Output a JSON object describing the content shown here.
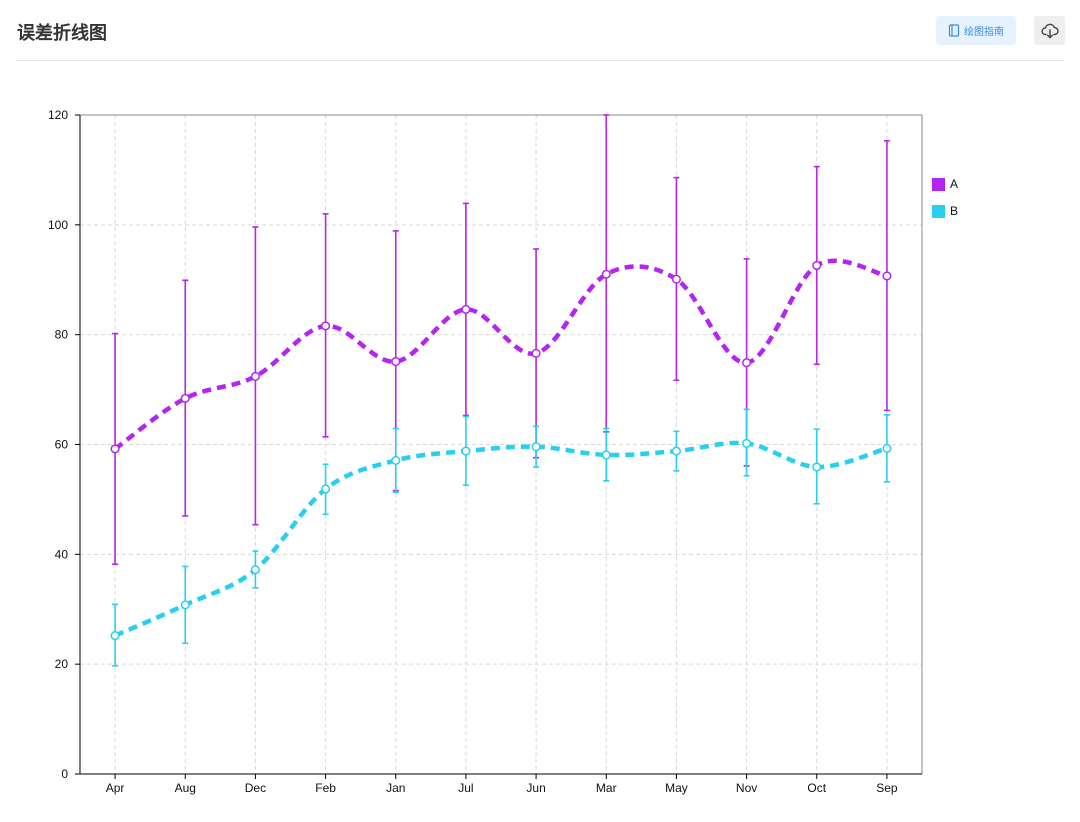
{
  "header": {
    "title": "误差折线图",
    "guide_label": "绘图指南",
    "guide_icon": "book-icon",
    "download_icon": "cloud-download-icon"
  },
  "chart_data": {
    "type": "line",
    "title": "",
    "xlabel": "",
    "ylabel": "",
    "categories": [
      "Apr",
      "Aug",
      "Dec",
      "Feb",
      "Jan",
      "Jul",
      "Jun",
      "Mar",
      "May",
      "Nov",
      "Oct",
      "Sep"
    ],
    "ylim": [
      0,
      120
    ],
    "yticks": [
      0,
      20,
      40,
      60,
      80,
      100,
      120
    ],
    "grid": true,
    "legend_position": "right",
    "line_style": "dashed-smooth",
    "series": [
      {
        "name": "A",
        "color": "#b425f0",
        "values": [
          59.2,
          68.4,
          72.4,
          81.6,
          75.1,
          84.6,
          76.6,
          91.0,
          90.1,
          74.9,
          92.6,
          90.7
        ],
        "error_low": [
          38.2,
          47.0,
          45.4,
          61.4,
          51.6,
          65.3,
          57.6,
          62.3,
          71.7,
          56.1,
          74.6,
          66.2
        ],
        "error_high": [
          80.2,
          89.9,
          99.6,
          102.0,
          98.9,
          103.9,
          95.6,
          120.0,
          108.6,
          93.8,
          110.6,
          115.3
        ]
      },
      {
        "name": "B",
        "color": "#29cfee",
        "values": [
          25.2,
          30.8,
          37.2,
          51.9,
          57.1,
          58.8,
          59.6,
          58.1,
          58.8,
          60.2,
          55.9,
          59.3
        ],
        "error_low": [
          19.7,
          23.8,
          33.9,
          47.3,
          51.3,
          52.6,
          55.9,
          53.4,
          55.2,
          54.3,
          49.2,
          53.2
        ],
        "error_high": [
          30.9,
          37.8,
          40.6,
          56.4,
          62.9,
          65.1,
          63.3,
          62.9,
          62.4,
          66.4,
          62.8,
          65.4
        ]
      }
    ]
  }
}
